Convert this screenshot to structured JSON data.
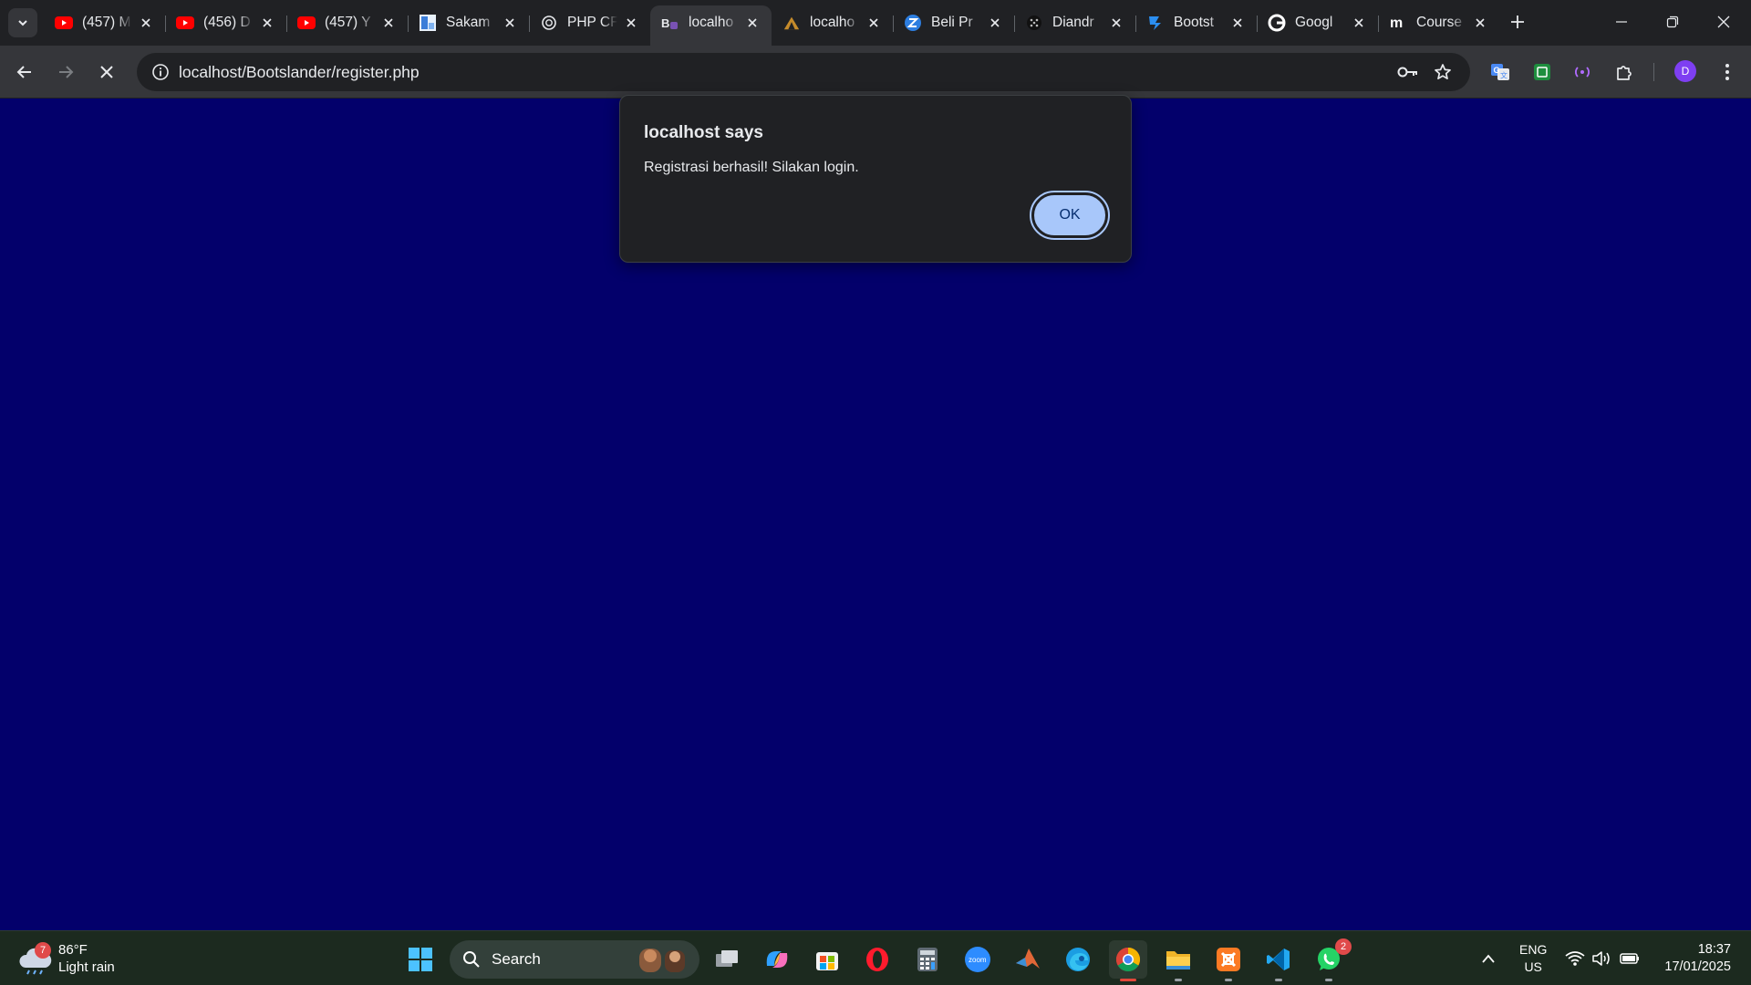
{
  "browser": {
    "tabs": [
      {
        "title": "(457) M",
        "favicon": "youtube-icon"
      },
      {
        "title": "(456) D",
        "favicon": "youtube-icon"
      },
      {
        "title": "(457) Y",
        "favicon": "youtube-icon"
      },
      {
        "title": "Sakam",
        "favicon": "sakam-icon"
      },
      {
        "title": "PHP CF",
        "favicon": "openai-icon"
      },
      {
        "title": "localho",
        "favicon": "bootstrap-icon",
        "active": true
      },
      {
        "title": "localho",
        "favicon": "tent-icon"
      },
      {
        "title": "Beli Pr",
        "favicon": "z-icon"
      },
      {
        "title": "Diandr",
        "favicon": "dots-icon"
      },
      {
        "title": "Bootst",
        "favicon": "bootstrap-blue-icon"
      },
      {
        "title": "Googl",
        "favicon": "google-icon"
      },
      {
        "title": "Course",
        "favicon": "medium-icon"
      }
    ],
    "url": "localhost/Bootslander/register.php",
    "profile_initial": "D"
  },
  "dialog": {
    "title": "localhost says",
    "message": "Registrasi berhasil! Silakan login.",
    "ok_label": "OK"
  },
  "taskbar": {
    "weather": {
      "temp": "86°F",
      "condition": "Light rain",
      "badge": "7"
    },
    "search_label": "Search",
    "whatsapp_badge": "2",
    "lang_primary": "ENG",
    "lang_secondary": "US",
    "time": "18:37",
    "date": "17/01/2025"
  },
  "colors": {
    "page_background": "#03006b",
    "dialog_background": "#202124",
    "ok_button": "#a8c7fa"
  }
}
